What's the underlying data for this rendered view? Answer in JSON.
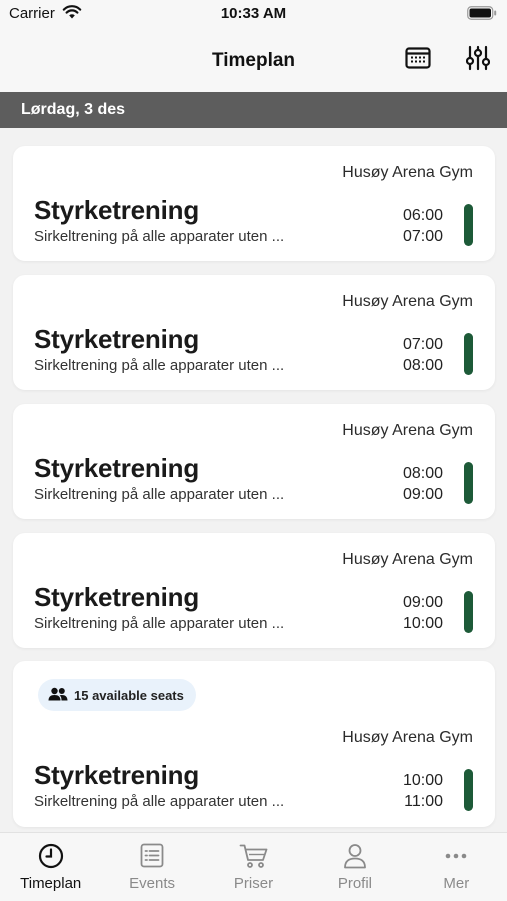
{
  "status_bar": {
    "carrier": "Carrier",
    "time": "10:33 AM"
  },
  "nav": {
    "title": "Timeplan",
    "calendar_icon": "calendar-icon",
    "filter_icon": "sliders-icon"
  },
  "date_header": "Lørdag, 3 des",
  "accent_color": "#1d5a38",
  "sessions": [
    {
      "venue": "Husøy Arena Gym",
      "title": "Styrketrening",
      "description": "Sirkeltrening på alle apparater uten ...",
      "start": "06:00",
      "end": "07:00"
    },
    {
      "venue": "Husøy Arena Gym",
      "title": "Styrketrening",
      "description": "Sirkeltrening på alle apparater uten ...",
      "start": "07:00",
      "end": "08:00"
    },
    {
      "venue": "Husøy Arena Gym",
      "title": "Styrketrening",
      "description": "Sirkeltrening på alle apparater uten ...",
      "start": "08:00",
      "end": "09:00"
    },
    {
      "venue": "Husøy Arena Gym",
      "title": "Styrketrening",
      "description": "Sirkeltrening på alle apparater uten ...",
      "start": "09:00",
      "end": "10:00"
    },
    {
      "badge": "15 available seats",
      "venue": "Husøy Arena Gym",
      "title": "Styrketrening",
      "description": "Sirkeltrening på alle apparater uten ...",
      "start": "10:00",
      "end": "11:00"
    }
  ],
  "tabs": [
    {
      "label": "Timeplan",
      "icon": "clock-icon",
      "active": true
    },
    {
      "label": "Events",
      "icon": "list-icon",
      "active": false
    },
    {
      "label": "Priser",
      "icon": "cart-icon",
      "active": false
    },
    {
      "label": "Profil",
      "icon": "person-icon",
      "active": false
    },
    {
      "label": "Mer",
      "icon": "more-icon",
      "active": false
    }
  ]
}
